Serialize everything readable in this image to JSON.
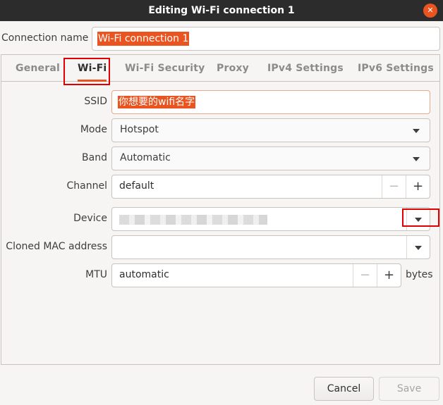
{
  "window": {
    "title": "Editing Wi-Fi connection 1",
    "close_glyph": "✕"
  },
  "connection": {
    "label": "Connection name",
    "value": "Wi-Fi connection 1"
  },
  "tabs": [
    {
      "label": "General",
      "active": false
    },
    {
      "label": "Wi-Fi",
      "active": true
    },
    {
      "label": "Wi-Fi Security",
      "active": false
    },
    {
      "label": "Proxy",
      "active": false
    },
    {
      "label": "IPv4 Settings",
      "active": false
    },
    {
      "label": "IPv6 Settings",
      "active": false
    }
  ],
  "form": {
    "ssid": {
      "label": "SSID",
      "value": "你想要的wifi名字"
    },
    "mode": {
      "label": "Mode",
      "value": "Hotspot"
    },
    "band": {
      "label": "Band",
      "value": "Automatic"
    },
    "channel": {
      "label": "Channel",
      "value": "default",
      "minus": "−",
      "plus": "+"
    },
    "device": {
      "label": "Device",
      "value": ""
    },
    "cloned_mac": {
      "label": "Cloned MAC address",
      "value": ""
    },
    "mtu": {
      "label": "MTU",
      "value": "automatic",
      "unit": "bytes",
      "minus": "−",
      "plus": "+"
    }
  },
  "buttons": {
    "cancel": "Cancel",
    "save": "Save"
  },
  "colors": {
    "accent": "#e95420",
    "annotation": "#e00000",
    "titlebar": "#2c2c2c"
  }
}
